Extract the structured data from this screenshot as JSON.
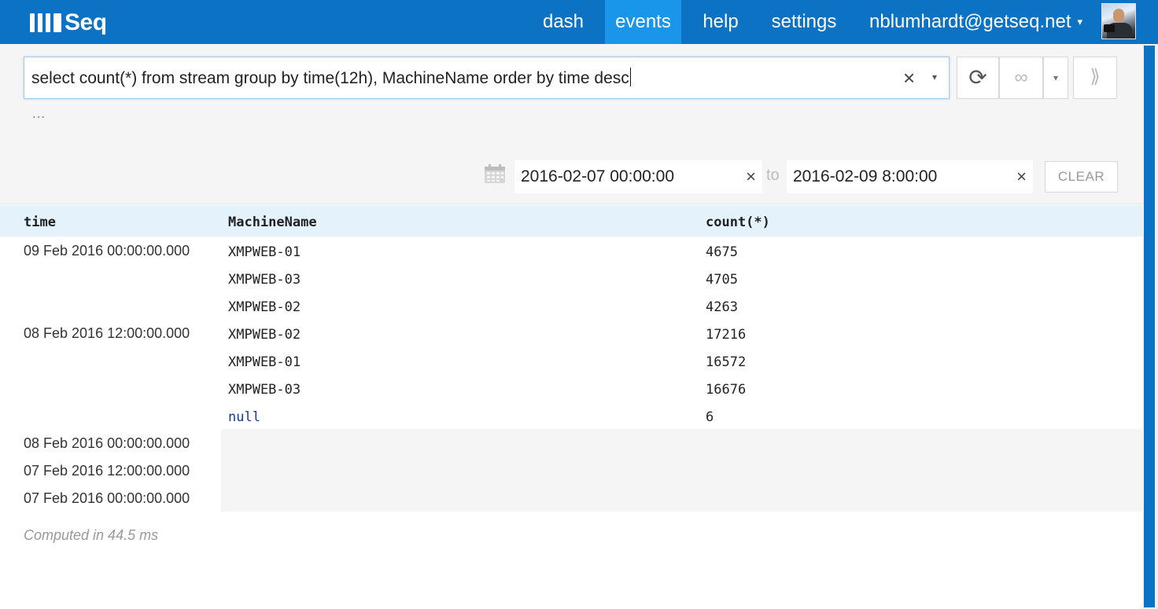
{
  "app": {
    "brand": "Seq"
  },
  "nav": {
    "dash": "dash",
    "events": "events",
    "help": "help",
    "settings": "settings",
    "user": "nblumhardt@getseq.net",
    "user_caret": "▾"
  },
  "query": {
    "text": "select count(*) from stream group by time(12h), MachineName order by time desc",
    "clear": "×",
    "dropdown": "▾",
    "ellipsis": "…"
  },
  "toolbar": {
    "refresh": "⟳",
    "tail": "∞",
    "tail_dropdown": "▾",
    "expand": "⟫"
  },
  "range": {
    "from": "2016-02-07 00:00:00",
    "to_label": "to",
    "to": "2016-02-09 8:00:00",
    "clear_x": "×",
    "clear_button": "CLEAR"
  },
  "table": {
    "headers": [
      "time",
      "MachineName",
      "count(*)"
    ],
    "rows": [
      {
        "time": "09 Feb 2016 00:00:00.000",
        "machine": "XMPWEB-01",
        "count": "4675"
      },
      {
        "time": "",
        "machine": "XMPWEB-03",
        "count": "4705"
      },
      {
        "time": "",
        "machine": "XMPWEB-02",
        "count": "4263"
      },
      {
        "time": "08 Feb 2016 12:00:00.000",
        "machine": "XMPWEB-02",
        "count": "17216"
      },
      {
        "time": "",
        "machine": "XMPWEB-01",
        "count": "16572"
      },
      {
        "time": "",
        "machine": "XMPWEB-03",
        "count": "16676"
      },
      {
        "time": "",
        "machine": "null",
        "count": "6"
      }
    ],
    "empty_rows": [
      "08 Feb 2016 00:00:00.000",
      "07 Feb 2016 12:00:00.000",
      "07 Feb 2016 00:00:00.000"
    ]
  },
  "footer": {
    "computed": "Computed in 44.5 ms"
  },
  "colors": {
    "nav_bg": "#0b72c4",
    "nav_active": "#1995ea",
    "header_bg": "#e4f2fc",
    "null_value": "#1b3b84"
  }
}
